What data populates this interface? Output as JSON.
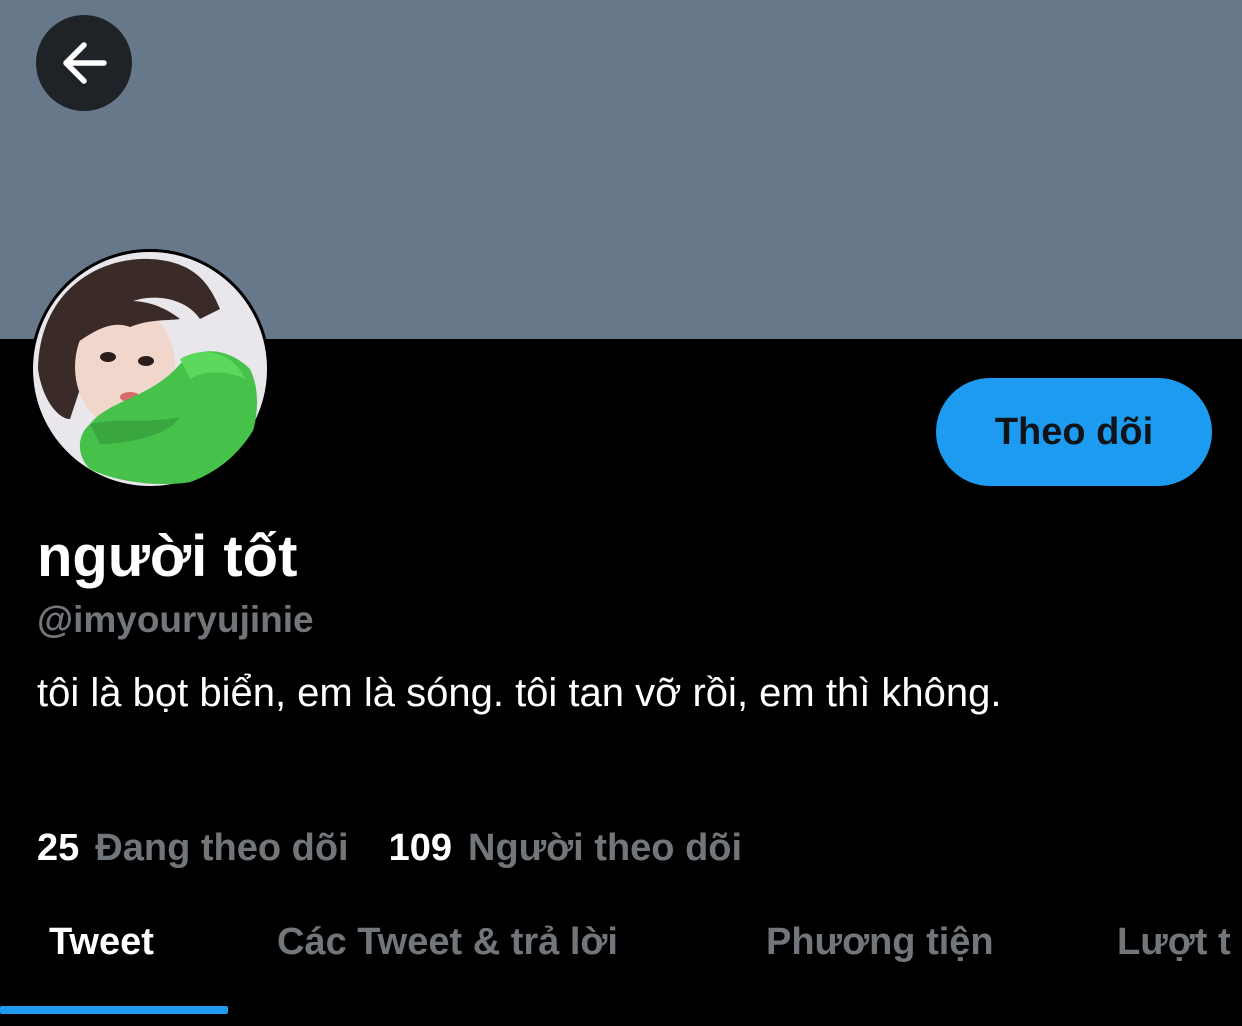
{
  "profile": {
    "display_name": "người tốt",
    "handle": "@imyouryujinie",
    "bio": "tôi là bọt biển, em là sóng. tôi tan vỡ rồi, em thì không.",
    "follow_label": "Theo dõi"
  },
  "stats": {
    "following_count": "25",
    "following_label": "Đang theo dõi",
    "followers_count": "109",
    "followers_label": "Người theo dõi"
  },
  "tabs": [
    {
      "label": "Tweet",
      "active": true
    },
    {
      "label": "Các Tweet & trả lời",
      "active": false
    },
    {
      "label": "Phương tiện",
      "active": false
    },
    {
      "label": "Lượt t",
      "active": false
    }
  ],
  "icons": {
    "back": "arrow-left-icon"
  },
  "colors": {
    "banner": "#66788a",
    "accent": "#1d9bf0",
    "background": "#000000",
    "secondary_text": "#71767b"
  }
}
